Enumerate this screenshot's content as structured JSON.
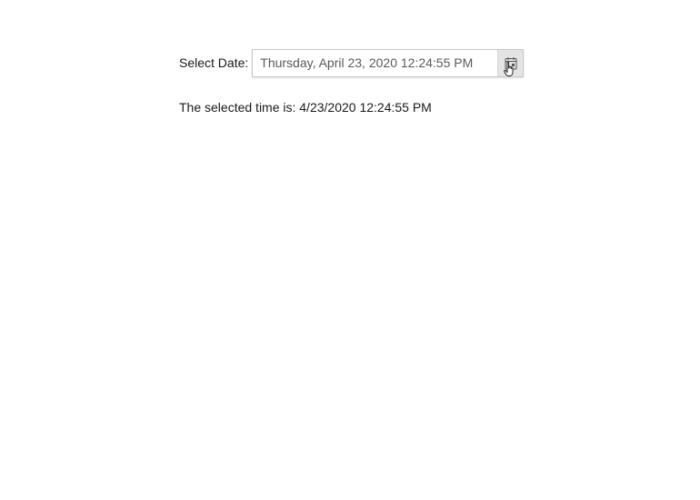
{
  "date_picker": {
    "label": "Select Date:",
    "value": "Thursday, April 23, 2020 12:24:55 PM",
    "button_icon": "calendar-icon"
  },
  "cursor": {
    "icon": "hand-pointer-icon"
  },
  "result": {
    "text": "The selected time is: 4/23/2020 12:24:55 PM"
  }
}
